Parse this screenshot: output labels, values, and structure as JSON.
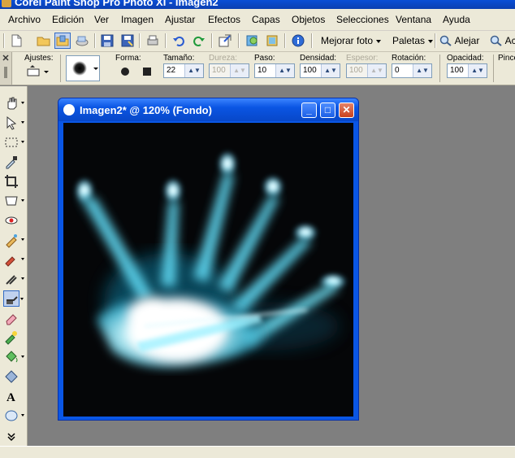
{
  "app": {
    "title": "Corel Paint Shop Pro Photo XI - Imagen2"
  },
  "menu": [
    {
      "label": "Archivo"
    },
    {
      "label": "Edición"
    },
    {
      "label": "Ver"
    },
    {
      "label": "Imagen"
    },
    {
      "label": "Ajustar"
    },
    {
      "label": "Efectos"
    },
    {
      "label": "Capas"
    },
    {
      "label": "Objetos"
    },
    {
      "label": "Selecciones"
    },
    {
      "label": "Ventana"
    },
    {
      "label": "Ayuda"
    }
  ],
  "toolbar": {
    "enhance_label": "Mejorar foto",
    "palettes_label": "Paletas",
    "zoom_out_label": "Alejar",
    "zoom_in_label": "Ac"
  },
  "options": {
    "presets_label": "Ajustes:",
    "shape_label": "Forma:",
    "size_label": "Tamaño:",
    "size_value": "22",
    "hardness_label": "Dureza:",
    "hardness_value": "100",
    "step_label": "Paso:",
    "step_value": "10",
    "density_label": "Densidad:",
    "density_value": "100",
    "thickness_label": "Espesor:",
    "thickness_value": "100",
    "rotation_label": "Rotación:",
    "rotation_value": "0",
    "opacity_label": "Opacidad:",
    "opacity_value": "100",
    "brush_label": "Pince"
  },
  "image_window": {
    "title": "Imagen2* @ 120% (Fondo)",
    "minimize": "_",
    "maximize": "□",
    "close": "✕"
  },
  "colors": {
    "accent": "#0a56e5",
    "glow": "#7fe8ff",
    "canvas": "#050608"
  }
}
